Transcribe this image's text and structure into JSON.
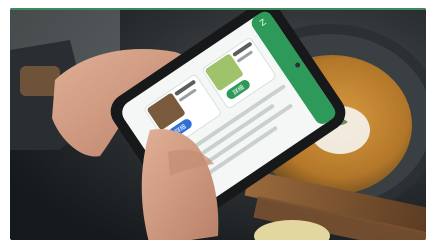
{
  "photo": {
    "colors": {
      "frame_white": "#ffffff",
      "top_rule": "#3f8a5c",
      "table_dark": "#1f2326",
      "bowl_rim": "#3a3f44",
      "soup": "#c8882e",
      "cream": "#f3efe6",
      "skin": "#d9a58a",
      "skin_shadow": "#b98068",
      "sleeve": "#2a2d31",
      "phone_body": "#161819",
      "screen": "#f5f7f6",
      "app_green": "#2e9a5a",
      "accent_blue": "#2f6fd6"
    },
    "screen": {
      "header_glyph": "Z",
      "card_1_button": "詳細",
      "card_2_button": "詳細"
    }
  }
}
